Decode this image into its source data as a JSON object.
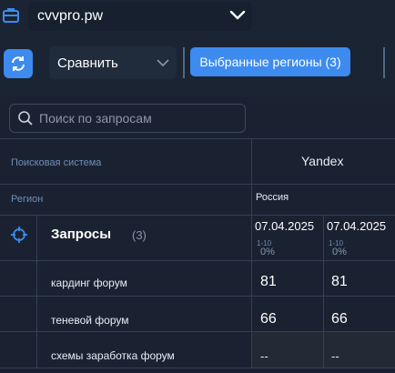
{
  "site_selector": {
    "value": "cvvpro.pw"
  },
  "toolbar": {
    "compare_label": "Сравнить",
    "regions_button": "Выбранные регионы (3)"
  },
  "search": {
    "placeholder": "Поиск по запросам"
  },
  "table": {
    "search_system_label": "Поисковая система",
    "search_system_value": "Yandex",
    "region_label": "Регион",
    "region_value": "Россия",
    "queries_title": "Запросы",
    "queries_count": "(3)",
    "columns": [
      {
        "date": "07.04.2025",
        "positions": "1-10",
        "percent": "0%"
      },
      {
        "date": "07.04.2025",
        "positions": "1-10",
        "percent": "0%"
      }
    ],
    "rows": [
      {
        "query": "кардинг форум",
        "values": [
          "81",
          "81"
        ]
      },
      {
        "query": "теневой форум",
        "values": [
          "66",
          "66"
        ]
      },
      {
        "query": "схемы заработка форум",
        "values": [
          "--",
          "--"
        ]
      }
    ]
  },
  "colors": {
    "accent": "#3d8bef",
    "background": "#1b2433",
    "muted_label": "#6f8fb7"
  }
}
